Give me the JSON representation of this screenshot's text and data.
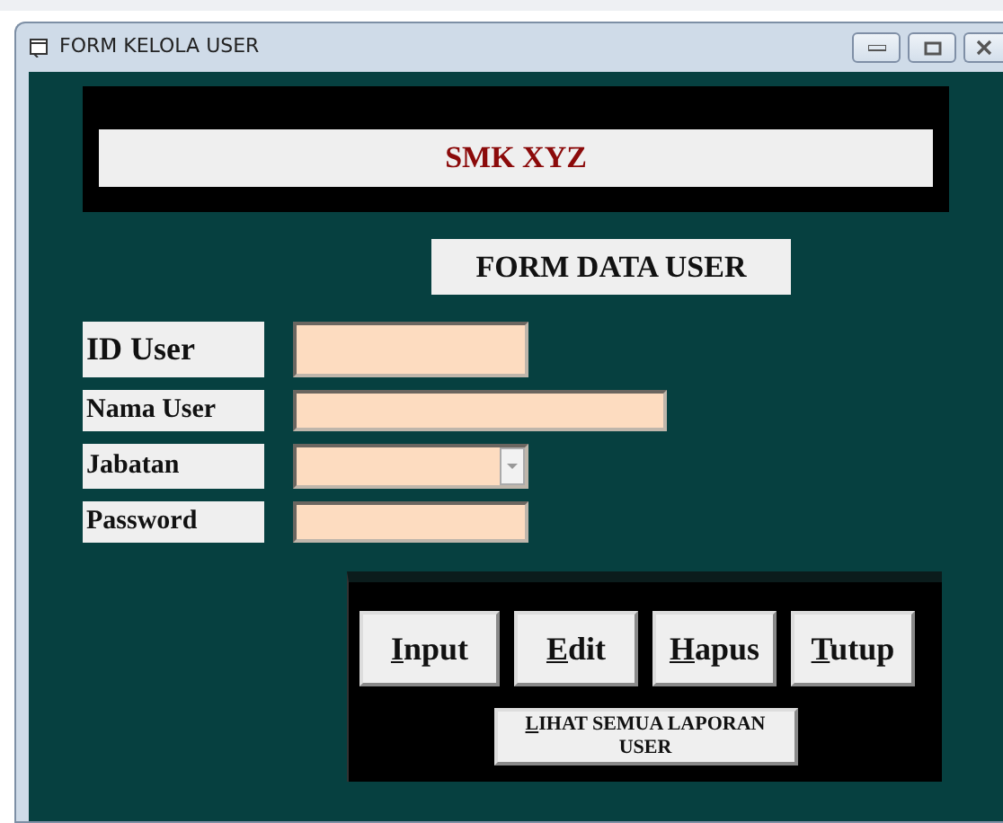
{
  "window": {
    "title": "FORM KELOLA USER"
  },
  "header": {
    "title": "SMK XYZ"
  },
  "form_title": "FORM DATA USER",
  "fields": [
    {
      "label": "ID User",
      "kind": "text"
    },
    {
      "label": "Nama User",
      "kind": "text"
    },
    {
      "label": "Jabatan",
      "kind": "combo"
    },
    {
      "label": "Password",
      "kind": "text"
    }
  ],
  "buttons": [
    "Input",
    "Edit",
    "Hapus",
    "Tutup"
  ],
  "report_button": "LIHAT SEMUA LAPORAN USER"
}
